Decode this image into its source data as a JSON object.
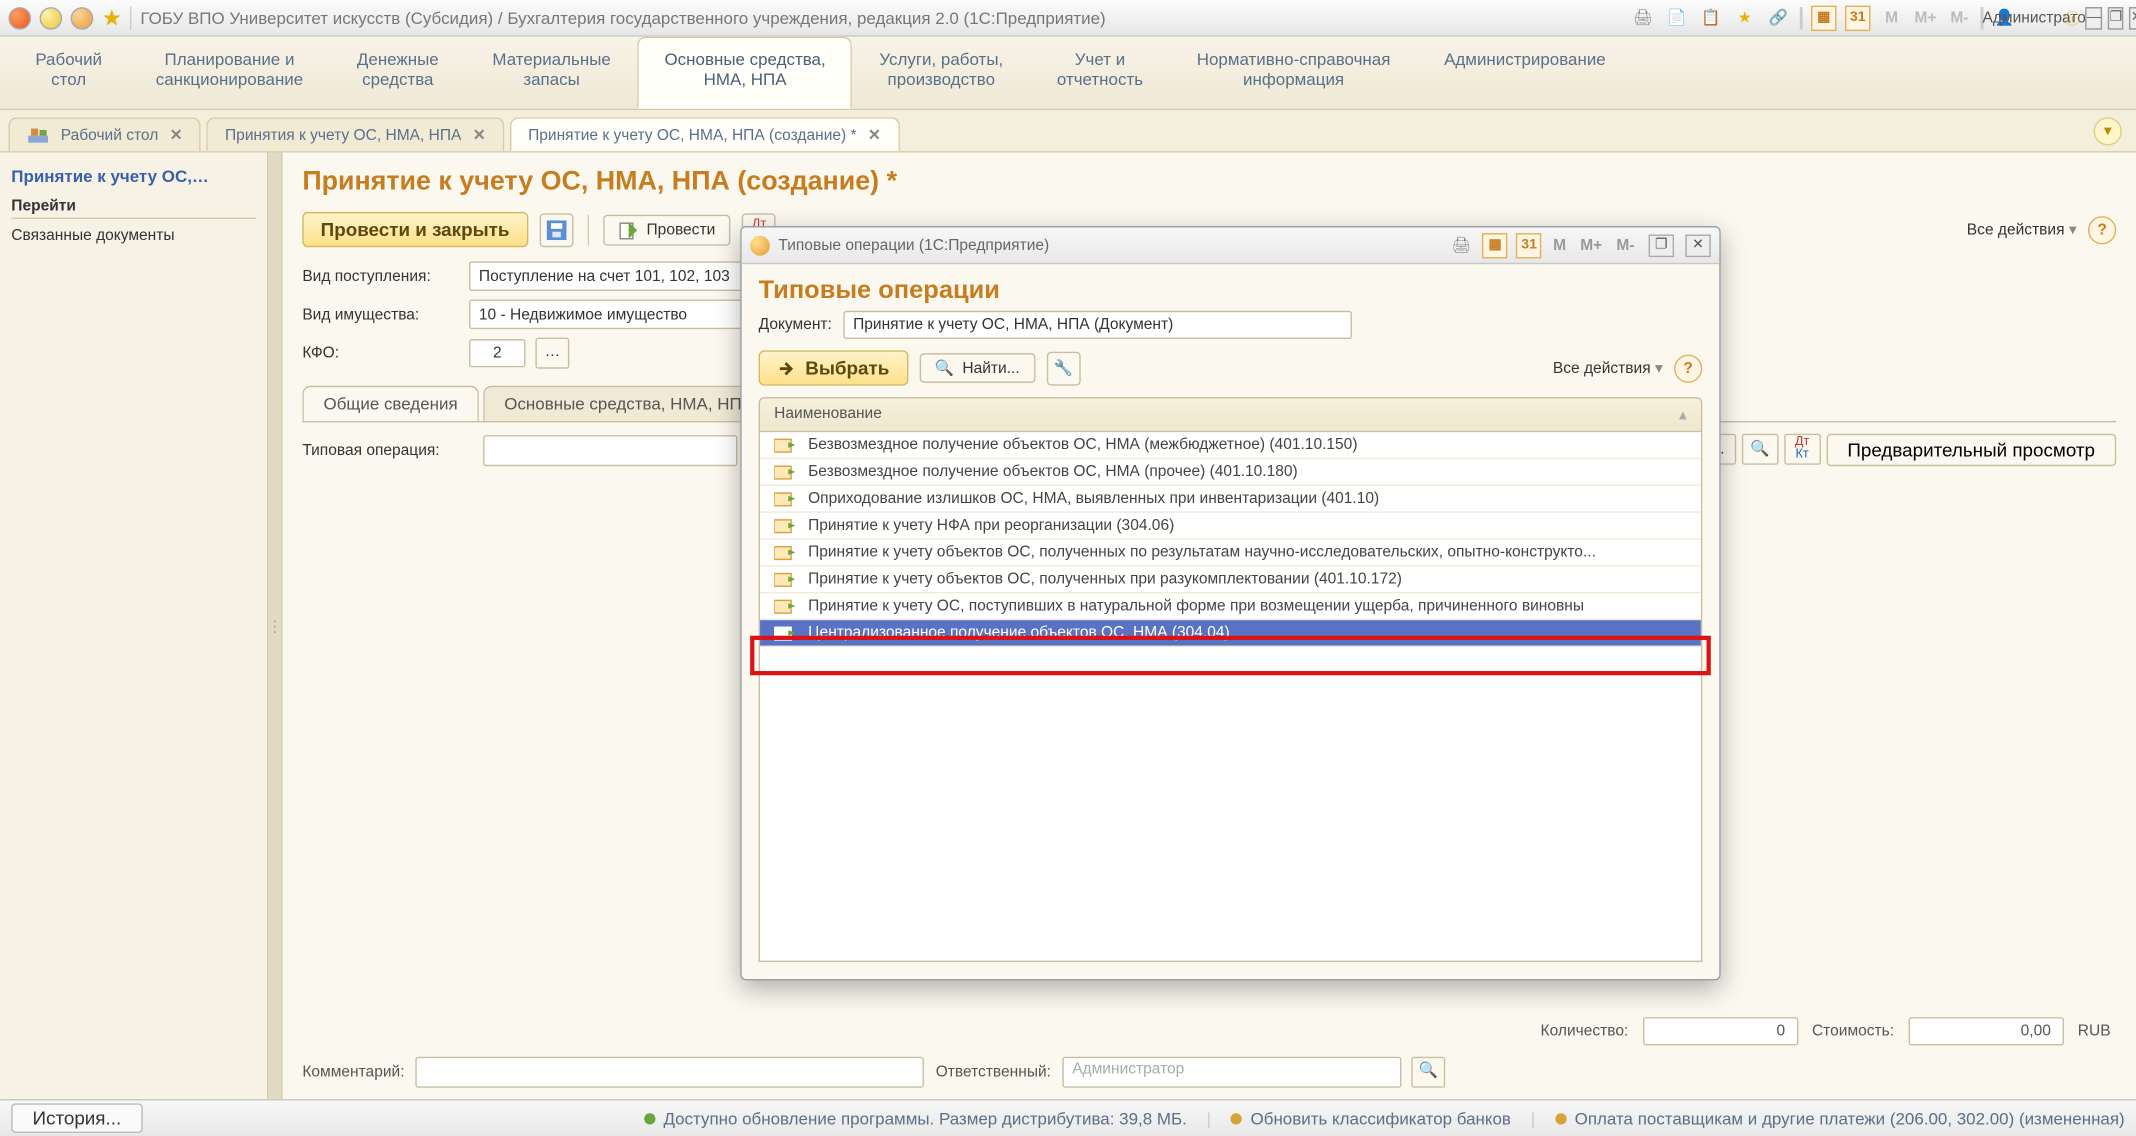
{
  "title_bar": {
    "app_title": "ГОБУ ВПО Университет искусств (Субсидия) / Бухгалтерия государственного учреждения, редакция 2.0  (1С:Предприятие)",
    "calendar_badge": "31",
    "m_labels": [
      "M",
      "M+",
      "M-"
    ],
    "user_label": "Администратор"
  },
  "section_tabs": [
    "Рабочий\nстол",
    "Планирование и\nсанкционирование",
    "Денежные\nсредства",
    "Материальные\nзапасы",
    "Основные средства,\nНМА, НПА",
    "Услуги, работы,\nпроизводство",
    "Учет и\nотчетность",
    "Нормативно-справочная\nинформация",
    "Администрирование"
  ],
  "section_active_index": 4,
  "open_tabs": [
    {
      "label": "Рабочий стол",
      "icon": true
    },
    {
      "label": "Принятия к учету ОС, НМА, НПА"
    },
    {
      "label": "Принятие к учету ОС, НМА, НПА (создание) *"
    }
  ],
  "open_tab_active_index": 2,
  "sidebar": {
    "header": "Принятие к учету ОС,…",
    "group": "Перейти",
    "link": "Связанные документы"
  },
  "page": {
    "title": "Принятие к учету ОС, НМА, НПА (создание) *",
    "toolbar": {
      "primary": "Провести и закрыть",
      "post": "Провести",
      "all_actions": "Все действия",
      "preview": "Предварительный просмотр"
    },
    "fields": {
      "receipt_type_label": "Вид поступления:",
      "receipt_type_value": "Поступление на счет 101, 102, 103",
      "property_type_label": "Вид имущества:",
      "property_type_value": "10 - Недвижимое имущество",
      "kfo_label": "КФО:",
      "kfo_value": "2"
    },
    "inner_tabs": [
      "Общие сведения",
      "Основные средства, НМА, НП"
    ],
    "inner_tab_active": 0,
    "typical_op_label": "Типовая операция:",
    "totals": {
      "qty_label": "Количество:",
      "qty_value": "0",
      "cost_label": "Стоимость:",
      "cost_value": "0,00",
      "currency": "RUB"
    },
    "footer": {
      "comment_label": "Комментарий:",
      "responsible_label": "Ответственный:",
      "responsible_value": "Администратор"
    }
  },
  "modal": {
    "window_title": "Типовые операции  (1С:Предприятие)",
    "calendar_badge": "31",
    "m_labels": [
      "M",
      "M+",
      "M-"
    ],
    "header": "Типовые операции",
    "doc_label": "Документ:",
    "doc_value": "Принятие к учету ОС, НМА, НПА (Документ)",
    "select_btn": "Выбрать",
    "find_btn": "Найти...",
    "all_actions": "Все действия",
    "col_header": "Наименование",
    "rows": [
      "Безвозмездное получение объектов ОС, НМА (межбюджетное) (401.10.150)",
      "Безвозмездное получение объектов ОС, НМА (прочее) (401.10.180)",
      "Оприходование излишков ОС, НМА, выявленных при инвентаризации (401.10)",
      "Принятие к учету НФА при реорганизации (304.06)",
      "Принятие к учету объектов ОС, полученных по результатам научно-исследовательских, опытно-конструкто...",
      "Принятие к учету объектов ОС, полученных при разукомплектовании (401.10.172)",
      "Принятие к учету ОС, поступивших в натуральной форме при возмещении ущерба, причиненного виновны",
      "Централизованное получение объектов ОС, НМА (304.04)"
    ],
    "selected_index": 7
  },
  "status_bar": {
    "history": "История...",
    "msg1": "Доступно обновление программы. Размер дистрибутива: 39,8 МБ.",
    "msg2": "Обновить классификатор банков",
    "msg3": "Оплата поставщикам и другие платежи (206.00, 302.00) (измененная)"
  }
}
